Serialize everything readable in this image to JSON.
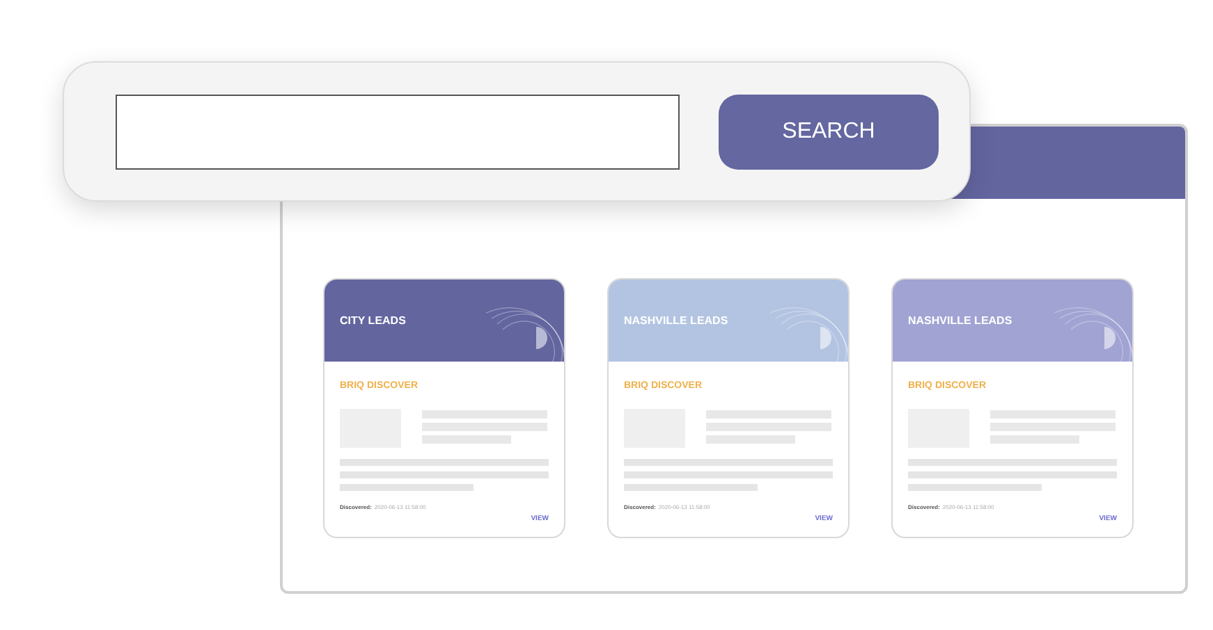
{
  "search": {
    "button": "SEARCH"
  },
  "cards": [
    {
      "title": "CITY LEADS",
      "color": "#63659f",
      "source": "BRIQ DISCOVER",
      "discovered_label": "Discovered:",
      "discovered_value": "2020-06-13 11:58:00",
      "link": "VIEW"
    },
    {
      "title": "NASHVILLE LEADS",
      "color": "#b3c4e2",
      "source": "BRIQ DISCOVER",
      "discovered_label": "Discovered:",
      "discovered_value": "2020-06-13 11:58:00",
      "link": "VIEW"
    },
    {
      "title": "NASHVILLE LEADS",
      "color": "#a1a3d3",
      "source": "BRIQ DISCOVER",
      "discovered_label": "Discovered:",
      "discovered_value": "2020-06-13 11:58:00",
      "link": "VIEW"
    }
  ]
}
